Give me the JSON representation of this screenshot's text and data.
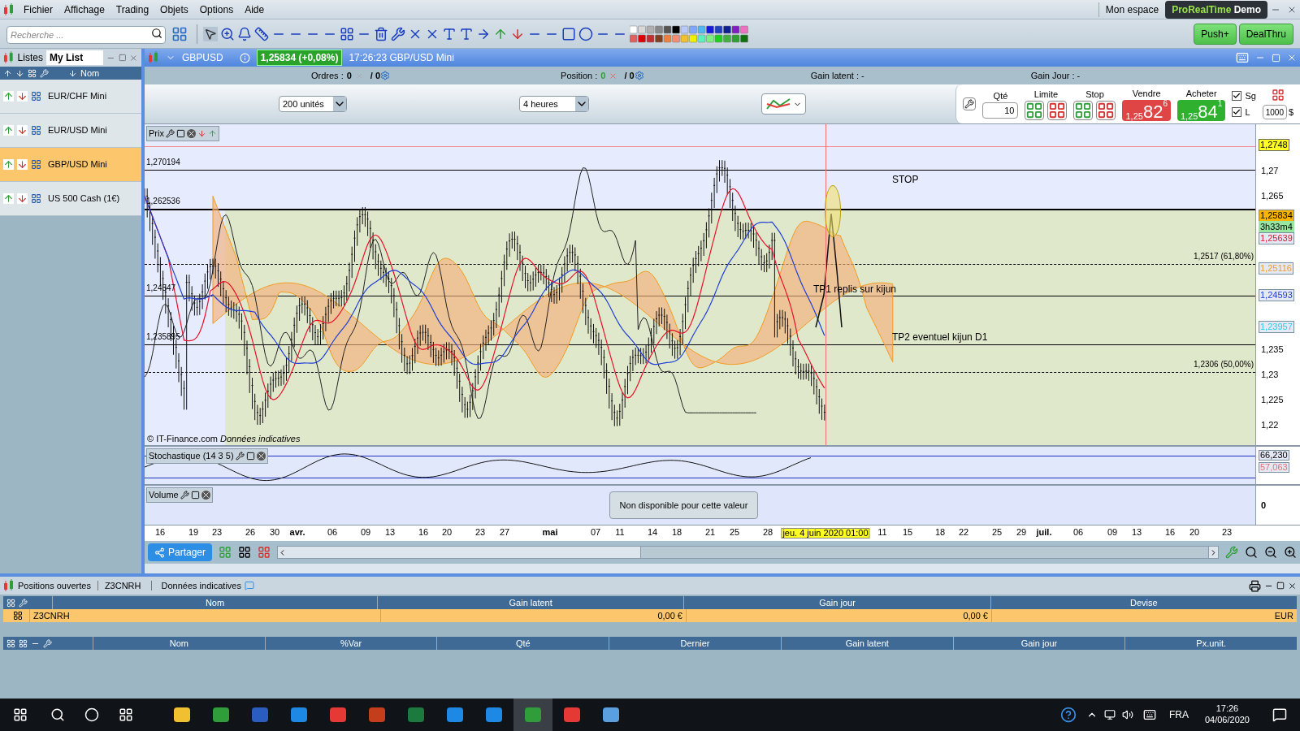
{
  "menu": [
    "Fichier",
    "Affichage",
    "Trading",
    "Objets",
    "Options",
    "Aide"
  ],
  "search": {
    "placeholder": "Recherche ..."
  },
  "account": {
    "label": "Mon espace",
    "product": "ProRealTime",
    "edition": "Demo"
  },
  "broker_buttons": [
    "Push+",
    "DealThru"
  ],
  "lists_panel": {
    "title": "Listes",
    "tab": "My List",
    "column": "Nom",
    "items": [
      {
        "name": "EUR/CHF Mini",
        "selected": false
      },
      {
        "name": "EUR/USD Mini",
        "selected": false
      },
      {
        "name": "GBP/USD Mini",
        "selected": true
      },
      {
        "name": "US 500 Cash (1€)",
        "selected": false
      }
    ]
  },
  "chart_window": {
    "symbol": "GBPUSD",
    "quote": "1,25834 (+0,08%)",
    "caption": "17:26:23 GBP/USD Mini",
    "orders_label": "Ordres :",
    "orders_value": "0",
    "orders_total": "/ 0",
    "position_label": "Position :",
    "position_value": "0",
    "position_total": "/ 0",
    "gain_latent": "Gain latent : -",
    "gain_jour": "Gain Jour : -",
    "units": "200 unités",
    "period": "4 heures"
  },
  "ticket": {
    "qty_label": "Qté",
    "qty": "10",
    "limit_label": "Limite",
    "stop_label": "Stop",
    "sell_label": "Vendre",
    "sell_prefix": "1,25",
    "sell_big": "82",
    "sell_sup": "6",
    "buy_label": "Acheter",
    "buy_prefix": "1,25",
    "buy_big": "84",
    "buy_sup": "1",
    "options": [
      {
        "label": "Sg",
        "checked": true
      },
      {
        "label": "L",
        "checked": true
      }
    ],
    "amount": "1000",
    "currency": "$"
  },
  "price_pane": {
    "title": "Prix",
    "levels": [
      {
        "label": "1,270194"
      },
      {
        "label": "1,262536"
      },
      {
        "label": "1,24547"
      },
      {
        "label": "1,235895"
      }
    ],
    "fib_labels": [
      "1,2517 (61,80%)",
      "1,2306 (50,00%)"
    ],
    "annotations": [
      "STOP",
      "TP1 replis sur kijun",
      "TP2 eventuel kijun D1"
    ],
    "copyright": "© IT-Finance.com",
    "data_note": "Données indicatives",
    "y_ticks": [
      "1,27",
      "1,265",
      "1,235",
      "1,23",
      "1,225",
      "1,22"
    ],
    "badges": [
      {
        "text": "1,2748",
        "kind": "high"
      },
      {
        "text": "1,25834",
        "kind": "last"
      },
      {
        "text": "3h33m4",
        "kind": "timer"
      },
      {
        "text": "1,25639",
        "kind": "plain",
        "color": "#e8102a"
      },
      {
        "text": "1,25116",
        "kind": "plain",
        "color": "#f39a1e"
      },
      {
        "text": "1,24593",
        "kind": "plain",
        "color": "#1f3fd8"
      },
      {
        "text": "1,23957",
        "kind": "plain",
        "color": "#22d3e6"
      }
    ]
  },
  "stochastic": {
    "title": "Stochastique (14 3 5)",
    "badges": [
      {
        "text": "66,230"
      },
      {
        "text": "57,063",
        "color": "#e87070"
      }
    ]
  },
  "volume": {
    "title": "Volume",
    "message": "Non disponible pour cette valeur",
    "tick": "0"
  },
  "x_axis": [
    {
      "label": "16",
      "kind": "day"
    },
    {
      "label": "19",
      "kind": "day"
    },
    {
      "label": "23",
      "kind": "day"
    },
    {
      "label": "26",
      "kind": "day"
    },
    {
      "label": "30",
      "kind": "day"
    },
    {
      "label": "avr.",
      "kind": "month"
    },
    {
      "label": "06",
      "kind": "day"
    },
    {
      "label": "09",
      "kind": "day"
    },
    {
      "label": "13",
      "kind": "day"
    },
    {
      "label": "16",
      "kind": "day"
    },
    {
      "label": "20",
      "kind": "day"
    },
    {
      "label": "23",
      "kind": "day"
    },
    {
      "label": "27",
      "kind": "day"
    },
    {
      "label": "mai",
      "kind": "month"
    },
    {
      "label": "07",
      "kind": "day"
    },
    {
      "label": "11",
      "kind": "day"
    },
    {
      "label": "14",
      "kind": "day"
    },
    {
      "label": "18",
      "kind": "day"
    },
    {
      "label": "21",
      "kind": "day"
    },
    {
      "label": "25",
      "kind": "day"
    },
    {
      "label": "28",
      "kind": "day"
    },
    {
      "label": "jeu. 4 juin 2020 01:00",
      "kind": "cursor"
    },
    {
      "label": "11",
      "kind": "day"
    },
    {
      "label": "15",
      "kind": "day"
    },
    {
      "label": "18",
      "kind": "day"
    },
    {
      "label": "22",
      "kind": "day"
    },
    {
      "label": "25",
      "kind": "day"
    },
    {
      "label": "29",
      "kind": "day"
    },
    {
      "label": "juil.",
      "kind": "month"
    },
    {
      "label": "06",
      "kind": "day"
    },
    {
      "label": "09",
      "kind": "day"
    },
    {
      "label": "13",
      "kind": "day"
    },
    {
      "label": "16",
      "kind": "day"
    },
    {
      "label": "20",
      "kind": "day"
    },
    {
      "label": "23",
      "kind": "day"
    }
  ],
  "share_button": "Partager",
  "positions_panel": {
    "title": "Positions ouvertes",
    "account": "Z3CNRH",
    "note": "Données indicatives",
    "columns": [
      "Nom",
      "Gain latent",
      "Gain jour",
      "Devise"
    ],
    "rows": [
      {
        "cells": [
          "Z3CNRH",
          "0,00 €",
          "0,00 €",
          "EUR"
        ],
        "selected": true
      }
    ],
    "columns_2": [
      "Nom",
      "%Var",
      "Qté",
      "Dernier",
      "Gain latent",
      "Gain jour",
      "Px.unit."
    ]
  },
  "taskbar": {
    "language": "FRA",
    "time": "17:26",
    "date": "04/06/2020"
  }
}
